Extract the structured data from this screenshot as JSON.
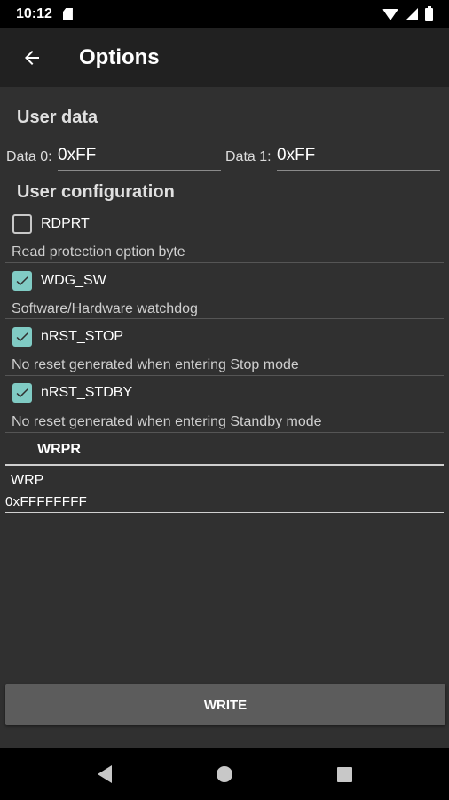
{
  "status_bar": {
    "time": "10:12",
    "icons": [
      "sd-card-icon",
      "wifi-icon",
      "signal-icon",
      "battery-icon"
    ]
  },
  "app_bar": {
    "title": "Options",
    "back_icon": "arrow-left-icon"
  },
  "user_data": {
    "title": "User data",
    "data0_label": "Data 0:",
    "data0_value": "0xFF",
    "data1_label": "Data 1:",
    "data1_value": "0xFF"
  },
  "user_configuration": {
    "title": "User configuration",
    "options": [
      {
        "label": "RDPRT",
        "checked": false,
        "description": "Read protection option byte"
      },
      {
        "label": "WDG_SW",
        "checked": true,
        "description": "Software/Hardware watchdog"
      },
      {
        "label": "nRST_STOP",
        "checked": true,
        "description": "No reset generated when entering Stop mode"
      },
      {
        "label": "nRST_STDBY",
        "checked": true,
        "description": "No reset generated when entering Standby mode"
      }
    ]
  },
  "wrpr": {
    "title": "WRPR",
    "field_label": "WRP",
    "field_value": "0xFFFFFFFF"
  },
  "write_button": {
    "label": "WRITE"
  },
  "colors": {
    "accent": "#80cbc4",
    "background": "#303030",
    "toolbar": "#212121",
    "button": "#5c5c5c"
  },
  "nav_bar": {
    "icons": [
      "nav-back-icon",
      "nav-home-icon",
      "nav-recents-icon"
    ]
  }
}
